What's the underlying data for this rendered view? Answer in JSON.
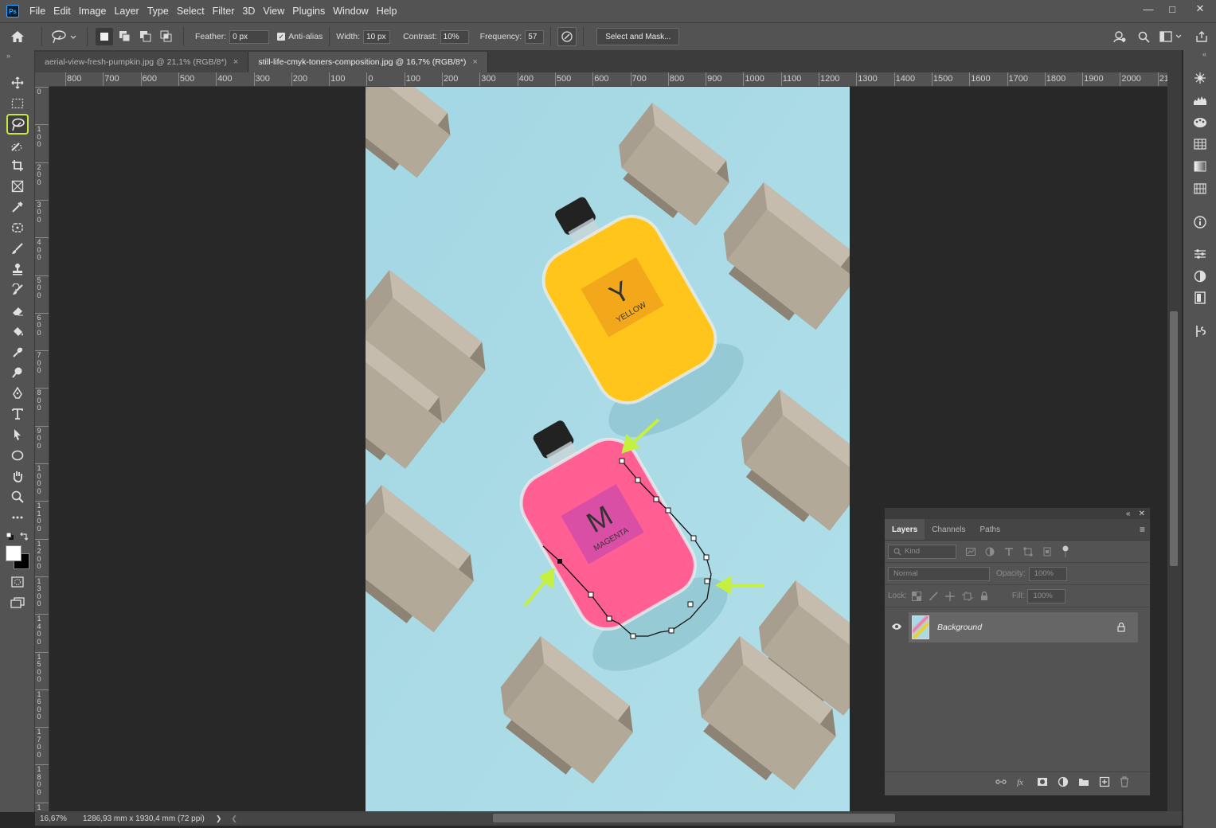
{
  "app": {
    "logo": "Ps"
  },
  "menu": [
    "File",
    "Edit",
    "Image",
    "Layer",
    "Type",
    "Select",
    "Filter",
    "3D",
    "View",
    "Plugins",
    "Window",
    "Help"
  ],
  "window_controls": [
    "—",
    "□",
    "✕"
  ],
  "options": {
    "feather_label": "Feather:",
    "feather_value": "0 px",
    "antialias_label": "Anti-alias",
    "antialias_checked": true,
    "width_label": "Width:",
    "width_value": "10 px",
    "contrast_label": "Contrast:",
    "contrast_value": "10%",
    "frequency_label": "Frequency:",
    "frequency_value": "57",
    "select_mask_label": "Select and Mask..."
  },
  "tabs": [
    {
      "label": "aerial-view-fresh-pumpkin.jpg @ 21,1% (RGB/8*)",
      "close": "×",
      "active": false
    },
    {
      "label": "still-life-cmyk-toners-composition.jpg @ 16,7% (RGB/8*)",
      "close": "×",
      "active": true
    }
  ],
  "ruler_h_labels": [
    "800",
    "700",
    "600",
    "500",
    "400",
    "300",
    "200",
    "100",
    "0",
    "100",
    "200",
    "300",
    "400",
    "500",
    "600",
    "700",
    "800",
    "900",
    "1000",
    "1100",
    "1200",
    "1300",
    "1400",
    "1500",
    "1600",
    "1700",
    "1800",
    "1900",
    "2000",
    "21"
  ],
  "ruler_v_labels": [
    "0",
    "1 0 0",
    "2 0 0",
    "3 0 0",
    "4 0 0",
    "5 0 0",
    "6 0 0",
    "7 0 0",
    "8 0 0",
    "9 0 0",
    "1 0 0 0",
    "1 1 0 0",
    "1 2 0 0",
    "1 3 0 0",
    "1 4 0 0",
    "1 5 0 0",
    "1 6 0 0",
    "1 7 0 0",
    "1 8 0 0",
    "1"
  ],
  "bottle_labels": {
    "yellow_letter": "Y",
    "yellow_word": "YELLOW",
    "magenta_letter": "M",
    "magenta_word": "MAGENTA"
  },
  "status": {
    "zoom": "16,67%",
    "doc_info": "1286,93 mm x 1930,4 mm (72 ppi)",
    "arrow_right": "❯",
    "arrow_left": "❮"
  },
  "layers_panel": {
    "collapse": "«",
    "close": "✕",
    "tabs": [
      "Layers",
      "Channels",
      "Paths"
    ],
    "menu_icon": "≡",
    "filter_kind": "Kind",
    "blend_mode": "Normal",
    "opacity_label": "Opacity:",
    "opacity_value": "100%",
    "lock_label": "Lock:",
    "fill_label": "Fill:",
    "fill_value": "100%",
    "layer_name": "Background"
  },
  "colors": {
    "accent_highlight": "#c6e842",
    "arrow_color": "#c6f040",
    "photo_bg": "#a8dbe6",
    "magenta": "#ff5f92",
    "yellow": "#ffc51a"
  }
}
